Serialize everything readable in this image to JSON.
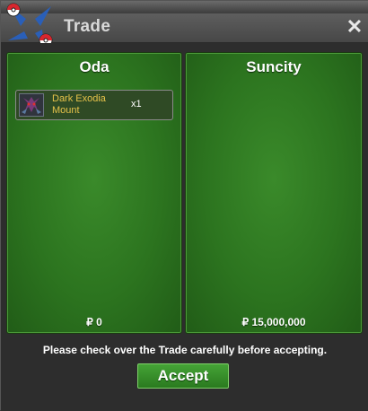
{
  "window": {
    "title": "Trade",
    "close_label": "✕"
  },
  "left_panel": {
    "name": "Oda",
    "money": "₽ 0",
    "items": [
      {
        "name": "Dark Exodia Mount",
        "quantity": "x1"
      }
    ]
  },
  "right_panel": {
    "name": "Suncity",
    "money": "₽ 15,000,000",
    "items": []
  },
  "notice": "Please check over the Trade carefully before accepting.",
  "accept_label": "Accept",
  "colors": {
    "panel_green": "#2c741f",
    "item_name": "#e6c24a",
    "accept_green": "#3a9030"
  }
}
